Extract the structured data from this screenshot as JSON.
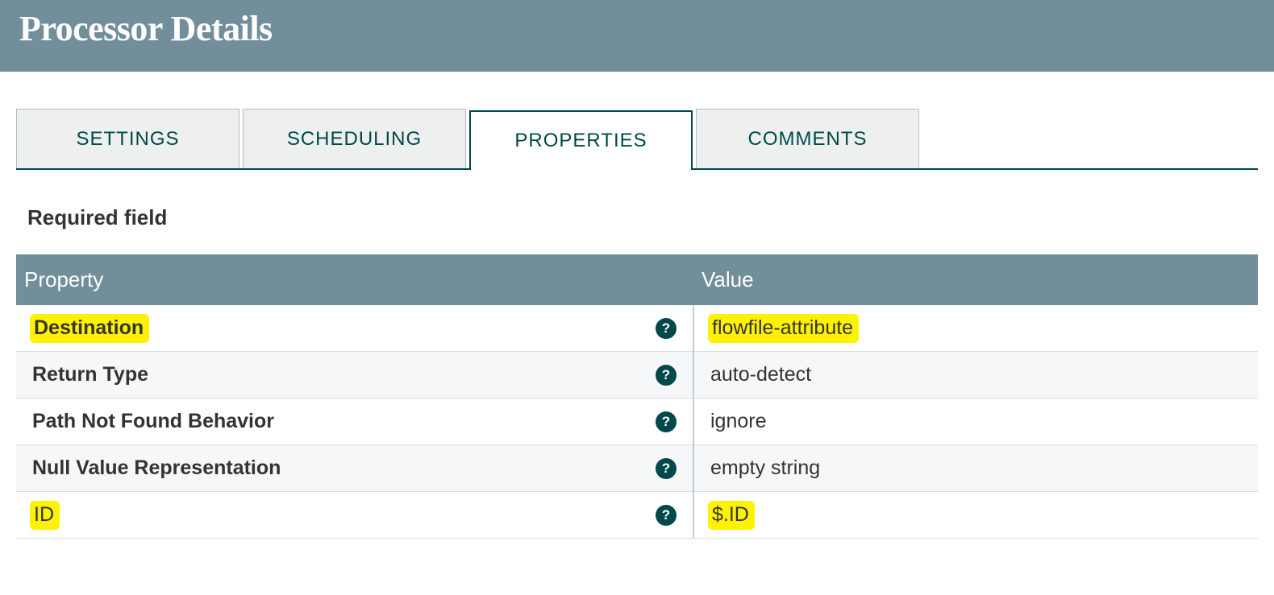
{
  "header": {
    "title": "Processor Details"
  },
  "tabs": {
    "settings": "SETTINGS",
    "scheduling": "SCHEDULING",
    "properties": "PROPERTIES",
    "comments": "COMMENTS"
  },
  "section_label": "Required field",
  "table": {
    "col_property": "Property",
    "col_value": "Value",
    "rows": [
      {
        "name": "Destination",
        "value": "flowfile-attribute",
        "bold": true,
        "highlight": true
      },
      {
        "name": "Return Type",
        "value": "auto-detect",
        "bold": true,
        "highlight": false
      },
      {
        "name": "Path Not Found Behavior",
        "value": "ignore",
        "bold": true,
        "highlight": false
      },
      {
        "name": "Null Value Representation",
        "value": "empty string",
        "bold": true,
        "highlight": false
      },
      {
        "name": "ID",
        "value": "$.ID",
        "bold": false,
        "highlight": true
      }
    ]
  },
  "help_glyph": "?"
}
